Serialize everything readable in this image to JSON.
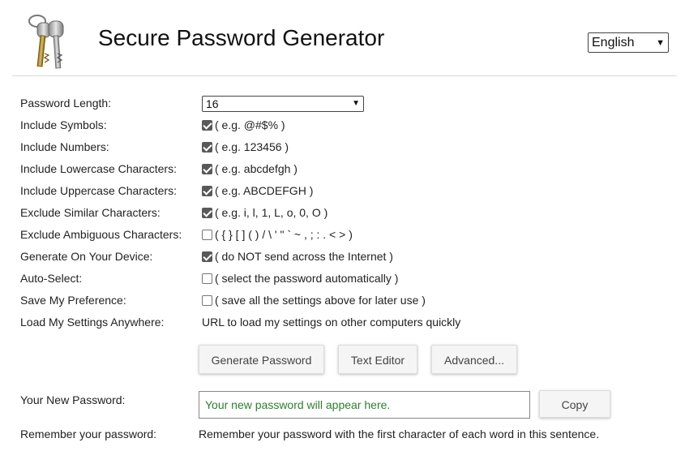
{
  "header": {
    "title": "Secure Password Generator",
    "language": "English"
  },
  "settings": {
    "length": {
      "label": "Password Length:",
      "value": "16"
    },
    "symbols": {
      "label": "Include Symbols:",
      "checked": true,
      "hint": "( e.g. @#$% )"
    },
    "numbers": {
      "label": "Include Numbers:",
      "checked": true,
      "hint": "( e.g. 123456 )"
    },
    "lowercase": {
      "label": "Include Lowercase Characters:",
      "checked": true,
      "hint": "( e.g. abcdefgh )"
    },
    "uppercase": {
      "label": "Include Uppercase Characters:",
      "checked": true,
      "hint": "( e.g. ABCDEFGH )"
    },
    "similar": {
      "label": "Exclude Similar Characters:",
      "checked": true,
      "hint": "( e.g. i, l, 1, L, o, 0, O )"
    },
    "ambiguous": {
      "label": "Exclude Ambiguous Characters:",
      "checked": false,
      "hint": "( { } [ ] ( ) / \\ ' \" ` ~ , ; : . < > )"
    },
    "on_device": {
      "label": "Generate On Your Device:",
      "checked": true,
      "hint": "( do NOT send across the Internet )"
    },
    "auto_select": {
      "label": "Auto-Select:",
      "checked": false,
      "hint": "( select the password automatically )"
    },
    "save_pref": {
      "label": "Save My Preference:",
      "checked": false,
      "hint": "( save all the settings above for later use )"
    },
    "load_anywhere": {
      "label": "Load My Settings Anywhere:",
      "value": "URL to load my settings on other computers quickly"
    }
  },
  "buttons": {
    "generate": "Generate Password",
    "text_editor": "Text Editor",
    "advanced": "Advanced...",
    "copy": "Copy"
  },
  "output": {
    "label": "Your New Password:",
    "placeholder": "Your new password will appear here.",
    "remember_label": "Remember your password:",
    "remember_text": "Remember your password with the first character of each word in this sentence."
  }
}
